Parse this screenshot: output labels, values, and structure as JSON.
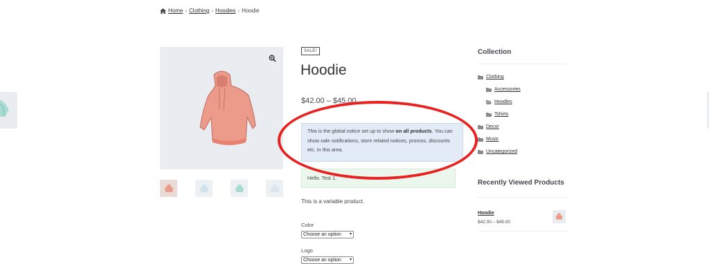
{
  "breadcrumb": {
    "home": "Home",
    "clothing": "Clothing",
    "hoodies": "Hoodies",
    "current": "Hoodie"
  },
  "product": {
    "badge": "SALE!",
    "title": "Hoodie",
    "price": "$42.00 – $45.00",
    "notice_part1": "This is the global notice set up to show ",
    "notice_bold": "on all products",
    "notice_part2": ". You can show sale notifications, store related notices, promos, discounts etc. in this area.",
    "hello": "Hello. Test 1.",
    "description": "This is a variable product.",
    "color_label": "Color",
    "color_select": "Choose an option",
    "logo_label": "Logo",
    "logo_select": "Choose an option"
  },
  "sidebar": {
    "collection_title": "Collection",
    "categories": [
      "Clothing",
      "Accessories",
      "Hoodies",
      "Tshirts",
      "Decor",
      "Music",
      "Uncategorized"
    ],
    "recent_title": "Recently Viewed Products",
    "recent_name": "Hoodie",
    "recent_price": "$42.00 – $45.00"
  },
  "colors": {
    "annotation": "#e8201f",
    "hoodie": "#ec9a8a",
    "hoodie_alt": "#a8dcd2"
  },
  "icons": [
    "home-icon",
    "zoom-icon",
    "folder-icon"
  ]
}
